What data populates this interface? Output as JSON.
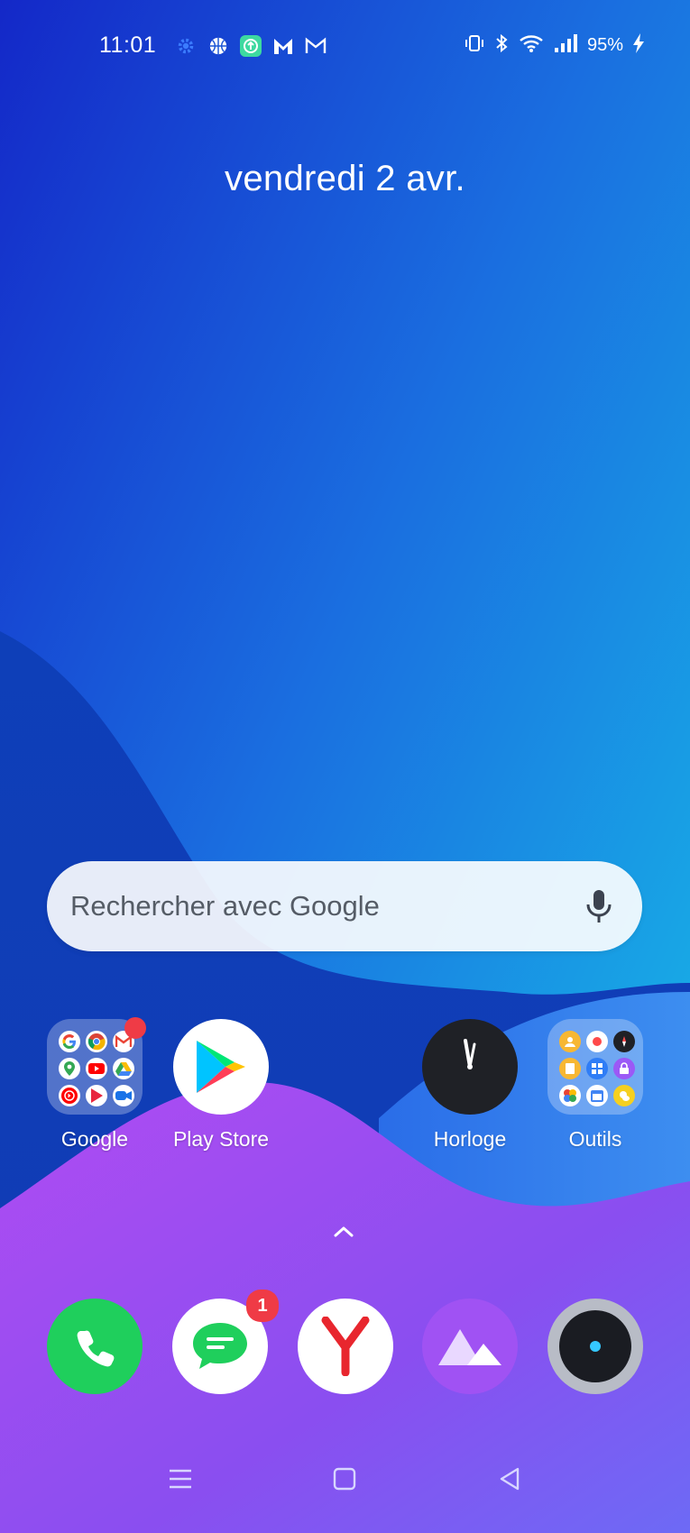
{
  "status_bar": {
    "time": "11:01",
    "battery_percent": "95%",
    "notification_icons": [
      "settings-gear-icon",
      "basketball-icon",
      "upload-app-icon",
      "m-app-icon",
      "gmail-icon"
    ],
    "system_icons": [
      "vibrate-icon",
      "bluetooth-icon",
      "wifi-icon",
      "cellular-signal-icon",
      "charging-bolt-icon"
    ]
  },
  "home": {
    "date": "vendredi 2 avr.",
    "search": {
      "placeholder": "Rechercher avec Google",
      "mic_icon": "microphone-icon"
    },
    "apps": [
      {
        "label": "Google",
        "type": "folder",
        "badge_dot": true
      },
      {
        "label": "Play Store",
        "type": "app"
      },
      {
        "label": "Horloge",
        "type": "app"
      },
      {
        "label": "Outils",
        "type": "folder"
      }
    ],
    "dock": [
      {
        "name": "phone",
        "icon": "phone-icon"
      },
      {
        "name": "messages",
        "icon": "message-icon",
        "badge": "1"
      },
      {
        "name": "yandex",
        "icon": "yandex-icon"
      },
      {
        "name": "gallery",
        "icon": "mountains-icon"
      },
      {
        "name": "camera",
        "icon": "camera-icon"
      }
    ]
  },
  "nav_bar": {
    "menu_icon": "menu-icon",
    "home_icon": "home-square-icon",
    "back_icon": "back-triangle-icon"
  },
  "colors": {
    "accent_blue": "#1565e0",
    "badge_red": "#ef3b46",
    "phone_green": "#22c55e",
    "gallery_purple": "#a855f7"
  }
}
